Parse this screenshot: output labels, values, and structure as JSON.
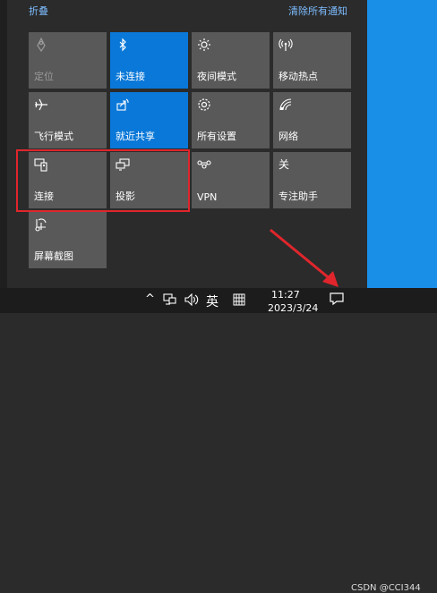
{
  "header": {
    "collapse_label": "折叠",
    "clear_label": "清除所有通知"
  },
  "tiles": [
    {
      "label": "定位",
      "icon": "location-icon",
      "state": "disabled"
    },
    {
      "label": "未连接",
      "icon": "bluetooth-icon",
      "state": "active"
    },
    {
      "label": "夜间模式",
      "icon": "brightness-icon",
      "state": "off"
    },
    {
      "label": "移动热点",
      "icon": "hotspot-icon",
      "state": "off"
    },
    {
      "label": "飞行模式",
      "icon": "airplane-icon",
      "state": "off"
    },
    {
      "label": "就近共享",
      "icon": "nearby-share-icon",
      "state": "active"
    },
    {
      "label": "所有设置",
      "icon": "gear-icon",
      "state": "off"
    },
    {
      "label": "网络",
      "icon": "network-icon",
      "state": "off"
    },
    {
      "label": "连接",
      "icon": "connect-icon",
      "state": "off"
    },
    {
      "label": "投影",
      "icon": "project-icon",
      "state": "off"
    },
    {
      "label": "VPN",
      "icon": "vpn-icon",
      "state": "off"
    },
    {
      "label": "专注助手",
      "icon": "focus-assist-icon",
      "state": "off"
    },
    {
      "label": "屏幕截图",
      "icon": "screen-snip-icon",
      "state": "off"
    }
  ],
  "taskbar": {
    "chevron": "^",
    "ime": "英",
    "time": "11:27",
    "date": "2023/3/24"
  },
  "watermark": "CSDN @CCI344",
  "colors": {
    "tile": "#595959",
    "tile_active": "#0a78d8",
    "highlight": "#e0262c",
    "desktop": "#1a8fe8"
  }
}
